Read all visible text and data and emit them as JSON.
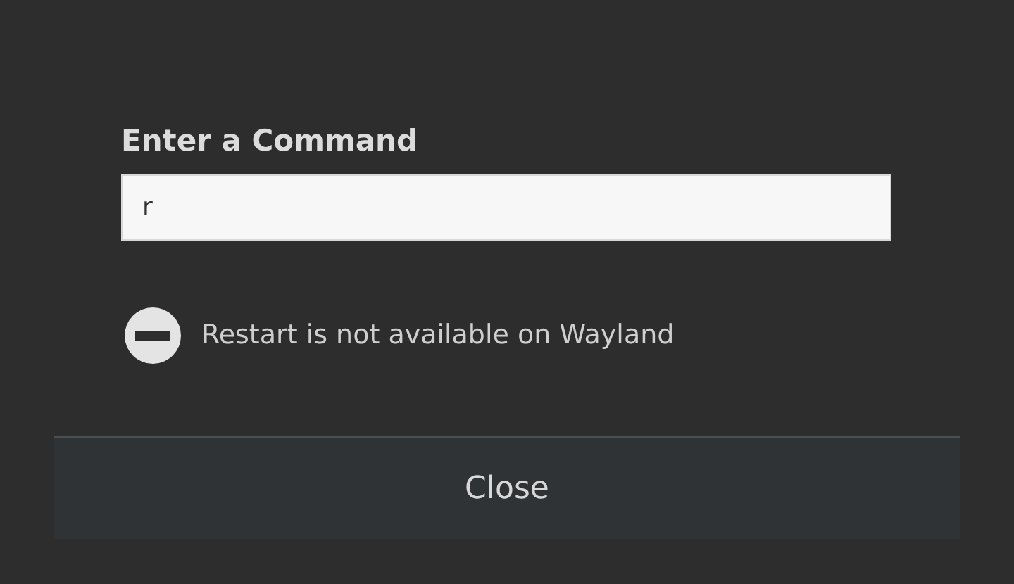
{
  "dialog": {
    "title": "Enter a Command",
    "command_field": {
      "value": "r"
    },
    "message": {
      "kind": "error",
      "text": "Restart is not available on Wayland"
    },
    "buttons": [
      "Close"
    ]
  }
}
